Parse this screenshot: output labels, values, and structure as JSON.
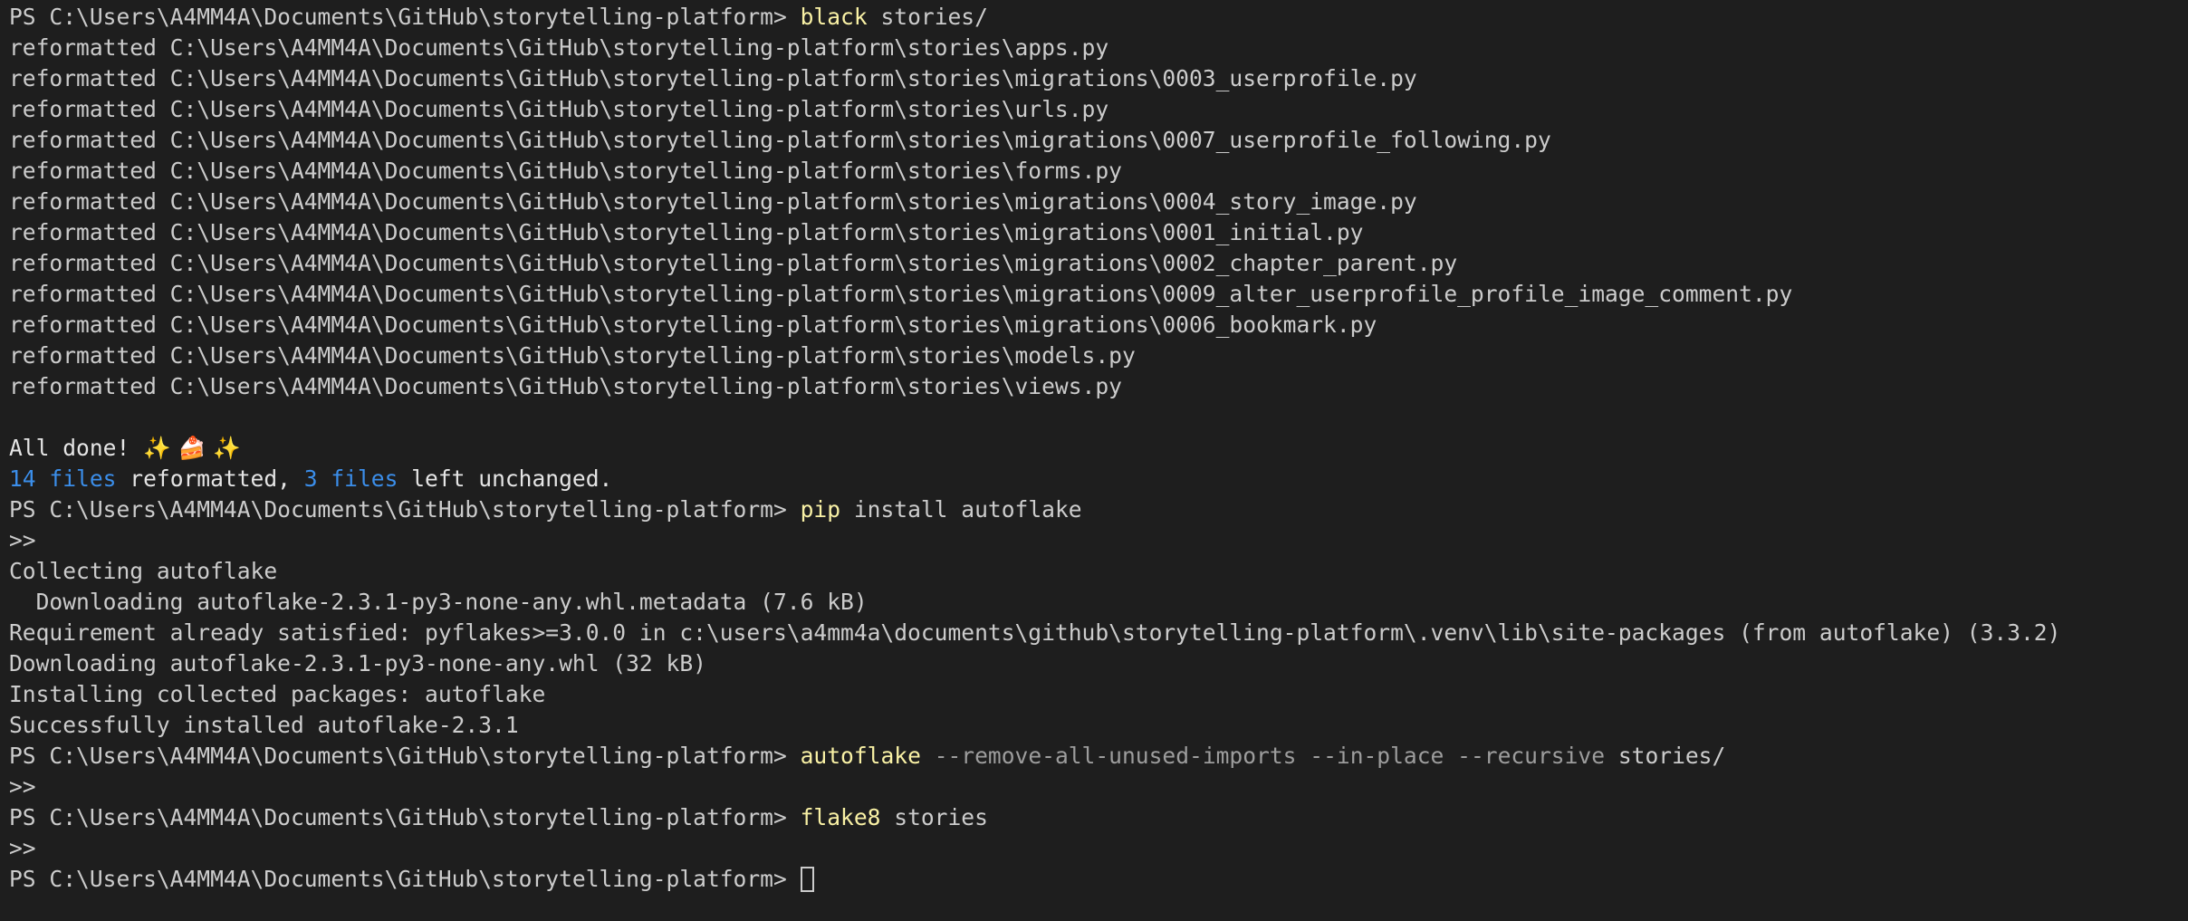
{
  "prompt": "PS C:\\Users\\A4MM4A\\Documents\\GitHub\\storytelling-platform> ",
  "commands": {
    "black": {
      "name": "black",
      "args": "stories/"
    },
    "pip": {
      "name": "pip",
      "args": "install autoflake"
    },
    "autoflake": {
      "name": "autoflake",
      "flags": "--remove-all-unused-imports --in-place --recursive",
      "args": "stories/"
    },
    "flake8": {
      "name": "flake8",
      "args": "stories"
    }
  },
  "continuation": ">>",
  "black_output": [
    "reformatted C:\\Users\\A4MM4A\\Documents\\GitHub\\storytelling-platform\\stories\\apps.py",
    "reformatted C:\\Users\\A4MM4A\\Documents\\GitHub\\storytelling-platform\\stories\\migrations\\0003_userprofile.py",
    "reformatted C:\\Users\\A4MM4A\\Documents\\GitHub\\storytelling-platform\\stories\\urls.py",
    "reformatted C:\\Users\\A4MM4A\\Documents\\GitHub\\storytelling-platform\\stories\\migrations\\0007_userprofile_following.py",
    "reformatted C:\\Users\\A4MM4A\\Documents\\GitHub\\storytelling-platform\\stories\\forms.py",
    "reformatted C:\\Users\\A4MM4A\\Documents\\GitHub\\storytelling-platform\\stories\\migrations\\0004_story_image.py",
    "reformatted C:\\Users\\A4MM4A\\Documents\\GitHub\\storytelling-platform\\stories\\migrations\\0001_initial.py",
    "reformatted C:\\Users\\A4MM4A\\Documents\\GitHub\\storytelling-platform\\stories\\migrations\\0002_chapter_parent.py",
    "reformatted C:\\Users\\A4MM4A\\Documents\\GitHub\\storytelling-platform\\stories\\migrations\\0009_alter_userprofile_profile_image_comment.py",
    "reformatted C:\\Users\\A4MM4A\\Documents\\GitHub\\storytelling-platform\\stories\\migrations\\0006_bookmark.py",
    "reformatted C:\\Users\\A4MM4A\\Documents\\GitHub\\storytelling-platform\\stories\\models.py",
    "reformatted C:\\Users\\A4MM4A\\Documents\\GitHub\\storytelling-platform\\stories\\views.py"
  ],
  "black_summary": {
    "done": "All done! ",
    "emoji": "✨ 🍰 ✨",
    "reformatted_count": "14 files",
    "reformatted_text": " reformatted, ",
    "unchanged_count": "3 files",
    "unchanged_text": " left unchanged."
  },
  "pip_output": [
    "Collecting autoflake",
    "  Downloading autoflake-2.3.1-py3-none-any.whl.metadata (7.6 kB)",
    "Requirement already satisfied: pyflakes>=3.0.0 in c:\\users\\a4mm4a\\documents\\github\\storytelling-platform\\.venv\\lib\\site-packages (from autoflake) (3.3.2)",
    "Downloading autoflake-2.3.1-py3-none-any.whl (32 kB)",
    "Installing collected packages: autoflake",
    "Successfully installed autoflake-2.3.1"
  ],
  "colors": {
    "background": "#1e1e1e",
    "foreground": "#cccccc",
    "command": "#f9f1a5",
    "flag": "#9d9d9d",
    "count": "#3b8eea"
  }
}
